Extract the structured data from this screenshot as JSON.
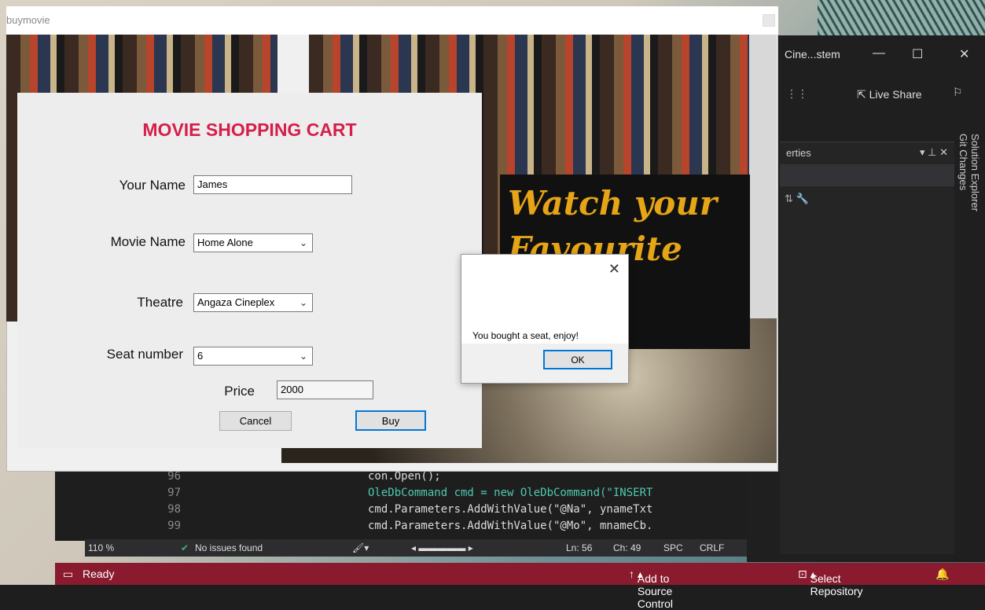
{
  "buymovie": {
    "title": "buymovie",
    "form": {
      "heading": "MOVIE SHOPPING CART",
      "your_name_label": "Your Name",
      "your_name_value": "James",
      "movie_name_label": "Movie Name",
      "movie_name_value": "Home Alone",
      "theatre_label": "Theatre",
      "theatre_value": "Angaza Cineplex",
      "seat_label": "Seat number",
      "seat_value": "6",
      "price_label": "Price",
      "price_value": "2000",
      "cancel_label": "Cancel",
      "buy_label": "Buy"
    },
    "banner_text": "Watch your Favourite Movie"
  },
  "messagebox": {
    "message": "You bought a seat, enjoy!",
    "ok_label": "OK"
  },
  "vs": {
    "title": "Cine...stem",
    "live_share": "Live Share",
    "properties_header": "erties",
    "side_tabs": [
      "Solution Explorer",
      "Git Changes"
    ],
    "code_lines": [
      {
        "num": "96",
        "text": "con.Open();"
      },
      {
        "num": "97",
        "text": "OleDbCommand cmd = new OleDbCommand(\"INSERT"
      },
      {
        "num": "98",
        "text": "cmd.Parameters.AddWithValue(\"@Na\", ynameTxt"
      },
      {
        "num": "99",
        "text": "cmd.Parameters.AddWithValue(\"@Mo\", mnameCb."
      }
    ],
    "editor_status": {
      "zoom": "110 %",
      "issues": "No issues found",
      "line": "Ln: 56",
      "col": "Ch: 49",
      "spc": "SPC",
      "crlf": "CRLF"
    },
    "status_bar": {
      "ready": "Ready",
      "add_source": "Add to Source Control",
      "select_repo": "Select Repository"
    }
  }
}
